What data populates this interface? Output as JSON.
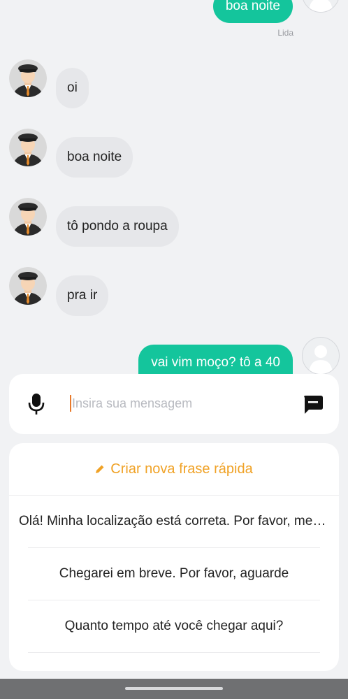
{
  "messages": [
    {
      "id": 0,
      "direction": "out",
      "text": "boa noite",
      "status": "Lida"
    },
    {
      "id": 1,
      "direction": "in",
      "text": "oi"
    },
    {
      "id": 2,
      "direction": "in",
      "text": "boa noite"
    },
    {
      "id": 3,
      "direction": "in",
      "text": "tô pondo a roupa"
    },
    {
      "id": 4,
      "direction": "in",
      "text": "pra ir"
    },
    {
      "id": 5,
      "direction": "out",
      "text": "vai vim moço? tô a 40"
    }
  ],
  "composer": {
    "placeholder": "Insira sua mensagem",
    "mic_icon": "microphone-icon",
    "quick_reply_icon": "quick-reply-icon"
  },
  "quick_replies": {
    "create_label": "Criar nova frase rápida",
    "create_icon": "pencil-icon",
    "items": [
      "Olá! Minha localização está correta. Por favor, me encontre aqui",
      "Chegarei em breve. Por favor, aguarde",
      "Quanto tempo até você chegar aqui?"
    ]
  },
  "colors": {
    "outgoing_bubble": "#14c59c",
    "incoming_bubble": "#e6e7ea",
    "accent_orange": "#f0a226",
    "caret": "#e8792a"
  }
}
